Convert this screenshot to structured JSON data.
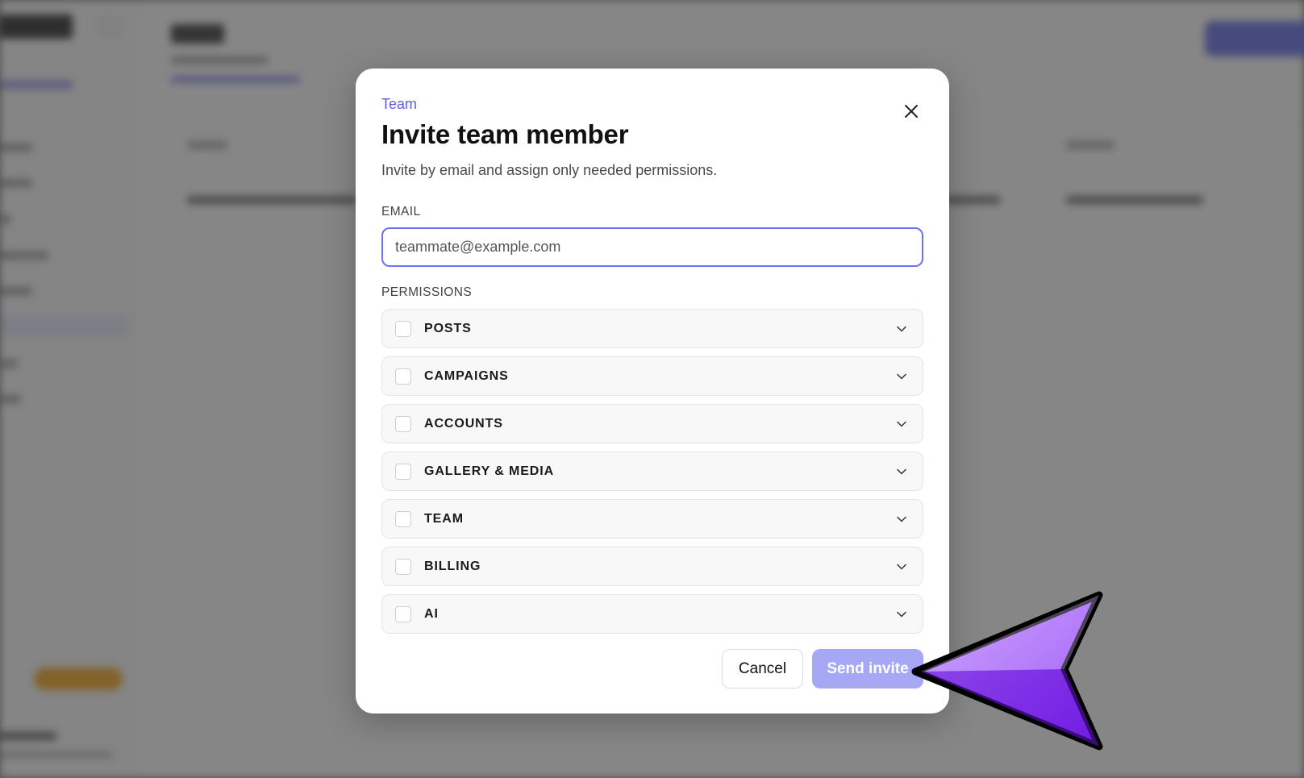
{
  "modal": {
    "eyebrow": "Team",
    "title": "Invite team member",
    "description": "Invite by email and assign only needed permissions.",
    "email_label": "EMAIL",
    "email_placeholder": "teammate@example.com",
    "email_value": "",
    "permissions_label": "PERMISSIONS",
    "permissions": [
      {
        "label": "POSTS",
        "checked": false
      },
      {
        "label": "CAMPAIGNS",
        "checked": false
      },
      {
        "label": "ACCOUNTS",
        "checked": false
      },
      {
        "label": "GALLERY & MEDIA",
        "checked": false
      },
      {
        "label": "TEAM",
        "checked": false
      },
      {
        "label": "BILLING",
        "checked": false
      },
      {
        "label": "AI",
        "checked": false
      }
    ],
    "cancel_label": "Cancel",
    "send_label": "Send invite",
    "close_icon": "close-icon",
    "chevron_icon": "chevron-down-icon"
  },
  "colors": {
    "accent": "#5a5ee6",
    "accent_disabled": "#a6a8f5",
    "overlay": "#3c3c3c",
    "cursor": "#8b2cf5"
  }
}
